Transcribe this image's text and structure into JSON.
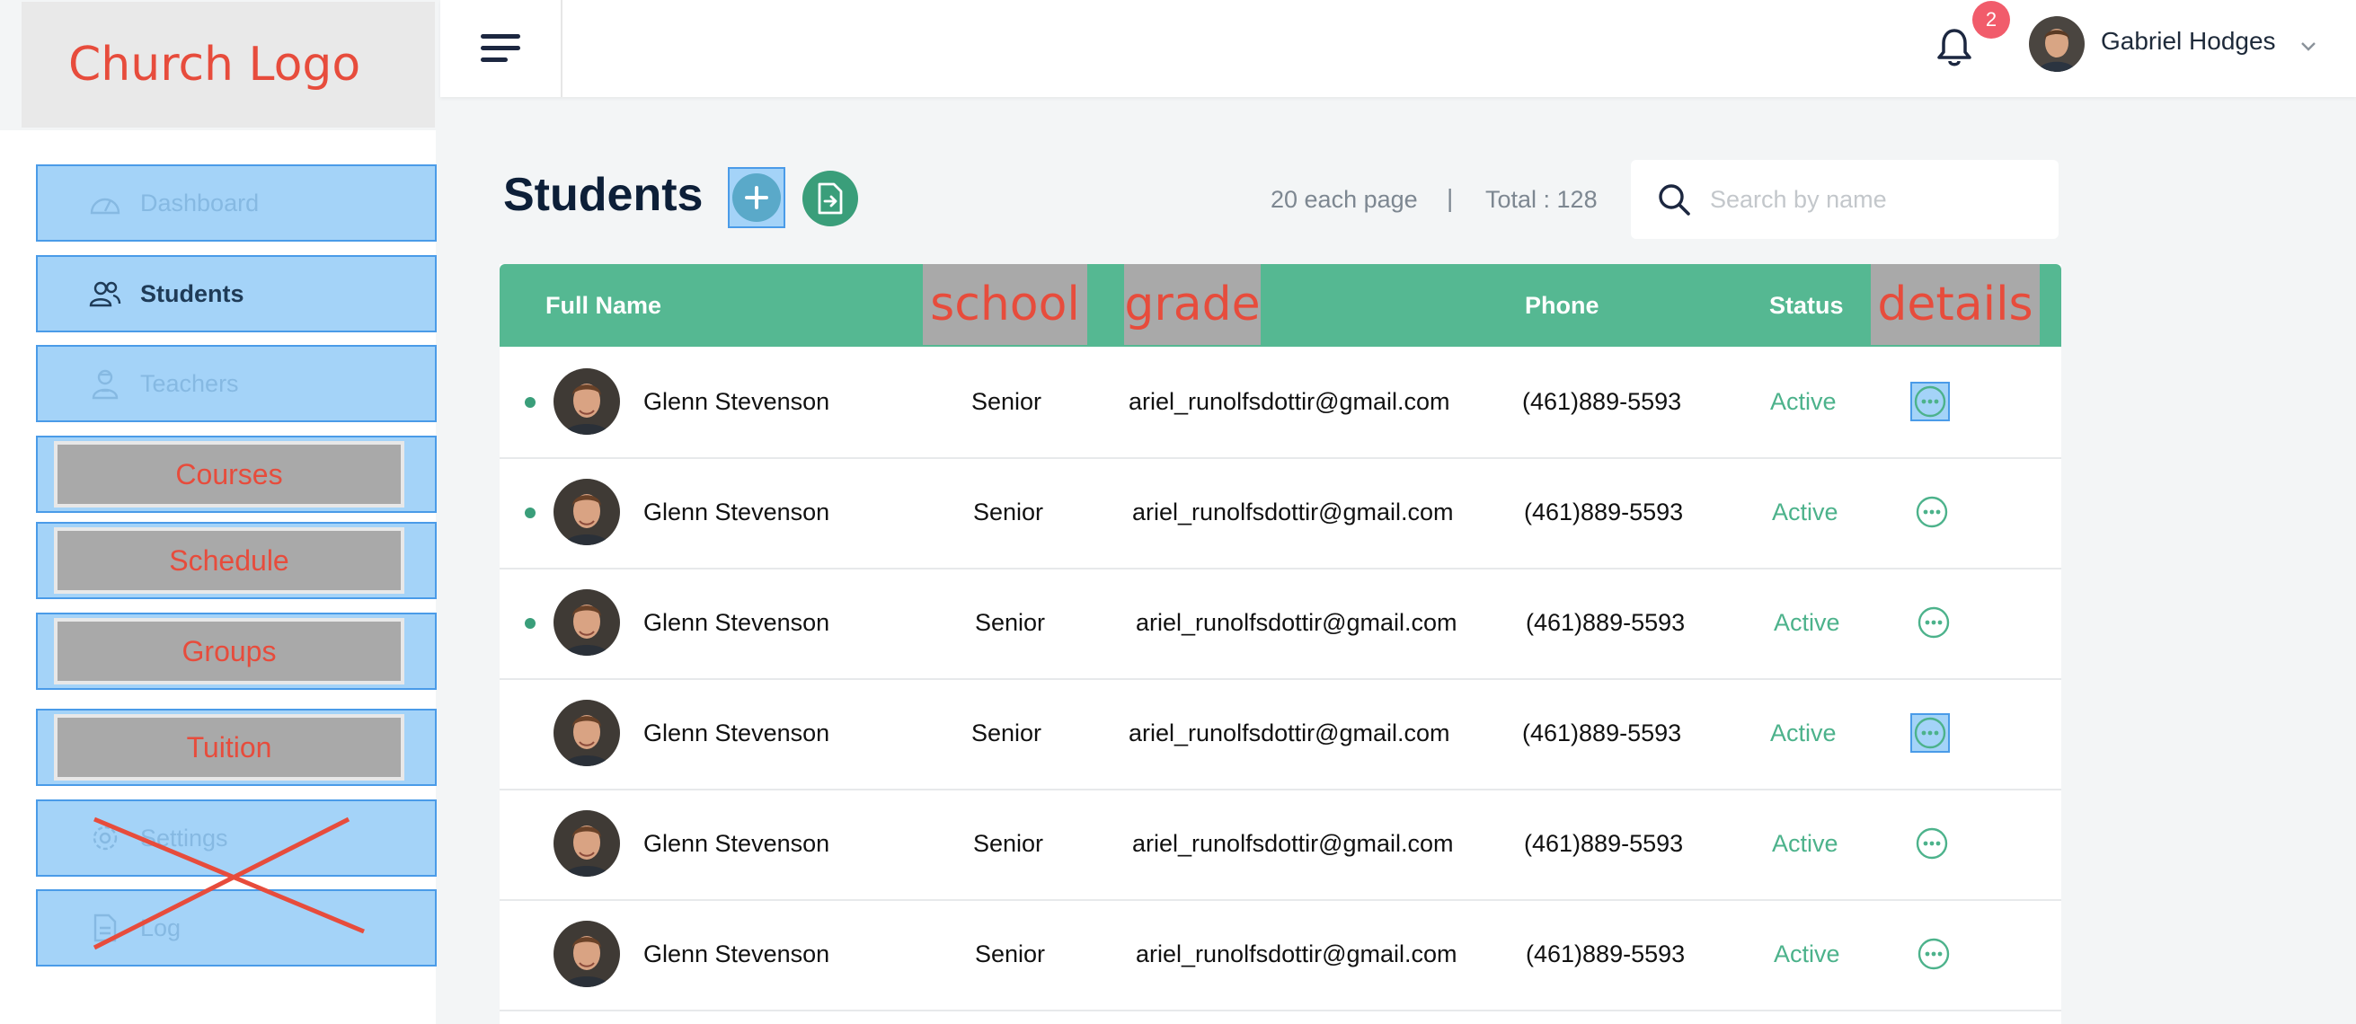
{
  "logo": {
    "text": "Church Logo"
  },
  "sidebar": {
    "items": [
      {
        "label": "Dashboard",
        "icon": "dashboard-icon"
      },
      {
        "label": "Students",
        "icon": "users-icon"
      },
      {
        "label": "Teachers",
        "icon": "teacher-icon"
      },
      {
        "label": "Courses"
      },
      {
        "label": "Schedule"
      },
      {
        "label": "Groups"
      },
      {
        "label": "Tuition"
      },
      {
        "label": "Settings",
        "icon": "gear-icon"
      },
      {
        "label": "Log",
        "icon": "document-icon"
      }
    ]
  },
  "header": {
    "notification_count": "2",
    "user_name": "Gabriel Hodges"
  },
  "page": {
    "title": "Students",
    "per_page": "20 each page",
    "separator": "|",
    "total": "Total : 128"
  },
  "search": {
    "placeholder": "Search by name"
  },
  "table": {
    "columns": {
      "full_name": "Full Name",
      "school": "school",
      "grade": "grade",
      "phone": "Phone",
      "status": "Status",
      "details": "details"
    },
    "rows": [
      {
        "name": "Glenn Stevenson",
        "grade": "Senior",
        "email": "ariel_runolfsdottir@gmail.com",
        "phone": "(461)889-5593",
        "status": "Active"
      },
      {
        "name": "Glenn Stevenson",
        "grade": "Senior",
        "email": "ariel_runolfsdottir@gmail.com",
        "phone": "(461)889-5593",
        "status": "Active"
      },
      {
        "name": "Glenn Stevenson",
        "grade": "Senior",
        "email": "ariel_runolfsdottir@gmail.com",
        "phone": "(461)889-5593",
        "status": "Active"
      },
      {
        "name": "Glenn Stevenson",
        "grade": "Senior",
        "email": "ariel_runolfsdottir@gmail.com",
        "phone": "(461)889-5593",
        "status": "Active"
      },
      {
        "name": "Glenn Stevenson",
        "grade": "Senior",
        "email": "ariel_runolfsdottir@gmail.com",
        "phone": "(461)889-5593",
        "status": "Active"
      },
      {
        "name": "Glenn Stevenson",
        "grade": "Senior",
        "email": "ariel_runolfsdottir@gmail.com",
        "phone": "(461)889-5593",
        "status": "Active"
      }
    ]
  },
  "colors": {
    "table_header": "#55b892",
    "status_active": "#4cb28b",
    "annotation_red": "#e74c3c",
    "highlight_blue": "#a4d3f8",
    "badge": "#f15c6b"
  }
}
